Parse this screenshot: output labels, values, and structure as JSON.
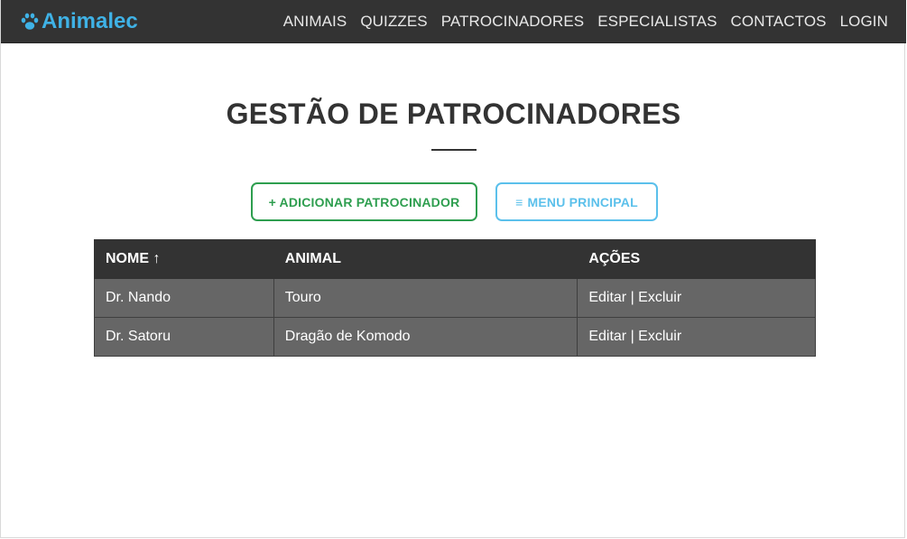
{
  "navbar": {
    "brand": "Animalec",
    "links": [
      "ANIMAIS",
      "QUIZZES",
      "PATROCINADORES",
      "ESPECIALISTAS",
      "CONTACTOS",
      "LOGIN"
    ]
  },
  "page": {
    "title": "GESTÃO DE PATROCINADORES"
  },
  "buttons": {
    "add_label": "+ ADICIONAR PATROCINADOR",
    "menu_icon": "≡",
    "menu_label": "MENU PRINCIPAL"
  },
  "table": {
    "headers": [
      "NOME ↑",
      "ANIMAL",
      "AÇÕES"
    ],
    "rows": [
      {
        "nome": "Dr. Nando",
        "animal": "Touro",
        "edit": "Editar",
        "sep": "|",
        "delete": "Excluir"
      },
      {
        "nome": "Dr. Satoru",
        "animal": "Dragão de Komodo",
        "edit": "Editar",
        "sep": "|",
        "delete": "Excluir"
      }
    ]
  },
  "colors": {
    "navbar_bg": "#333333",
    "brand": "#3fb2e6",
    "add_button": "#2e9e4f",
    "menu_button": "#5bc0eb",
    "row_bg": "#666666"
  }
}
